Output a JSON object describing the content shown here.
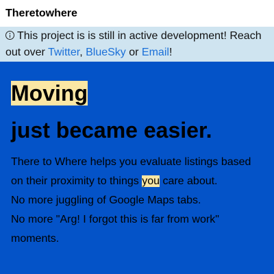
{
  "header": {
    "title": "Theretowhere"
  },
  "notice": {
    "icon": "info-icon",
    "text_before": "This project is is still in active development! Reach out over ",
    "link_twitter": "Twitter",
    "sep1": ", ",
    "link_bluesky": "BlueSky",
    "sep2": " or ",
    "link_email": "Email",
    "text_after": "!"
  },
  "hero": {
    "heading_highlight": "Moving",
    "heading_rest": "just became easier.",
    "desc_before": "There to Where helps you evaluate listings based on their proximity to things ",
    "desc_highlight": "you",
    "desc_after": " care about.",
    "line2": "No more juggling of Google Maps tabs.",
    "line3": "No more \"Arg! I forgot this is far from work\" moments."
  },
  "colors": {
    "hero_background": "#0453c8",
    "notice_background": "#cfe4f0",
    "highlight": "#fbe7a4",
    "link": "#1a6fd8"
  }
}
